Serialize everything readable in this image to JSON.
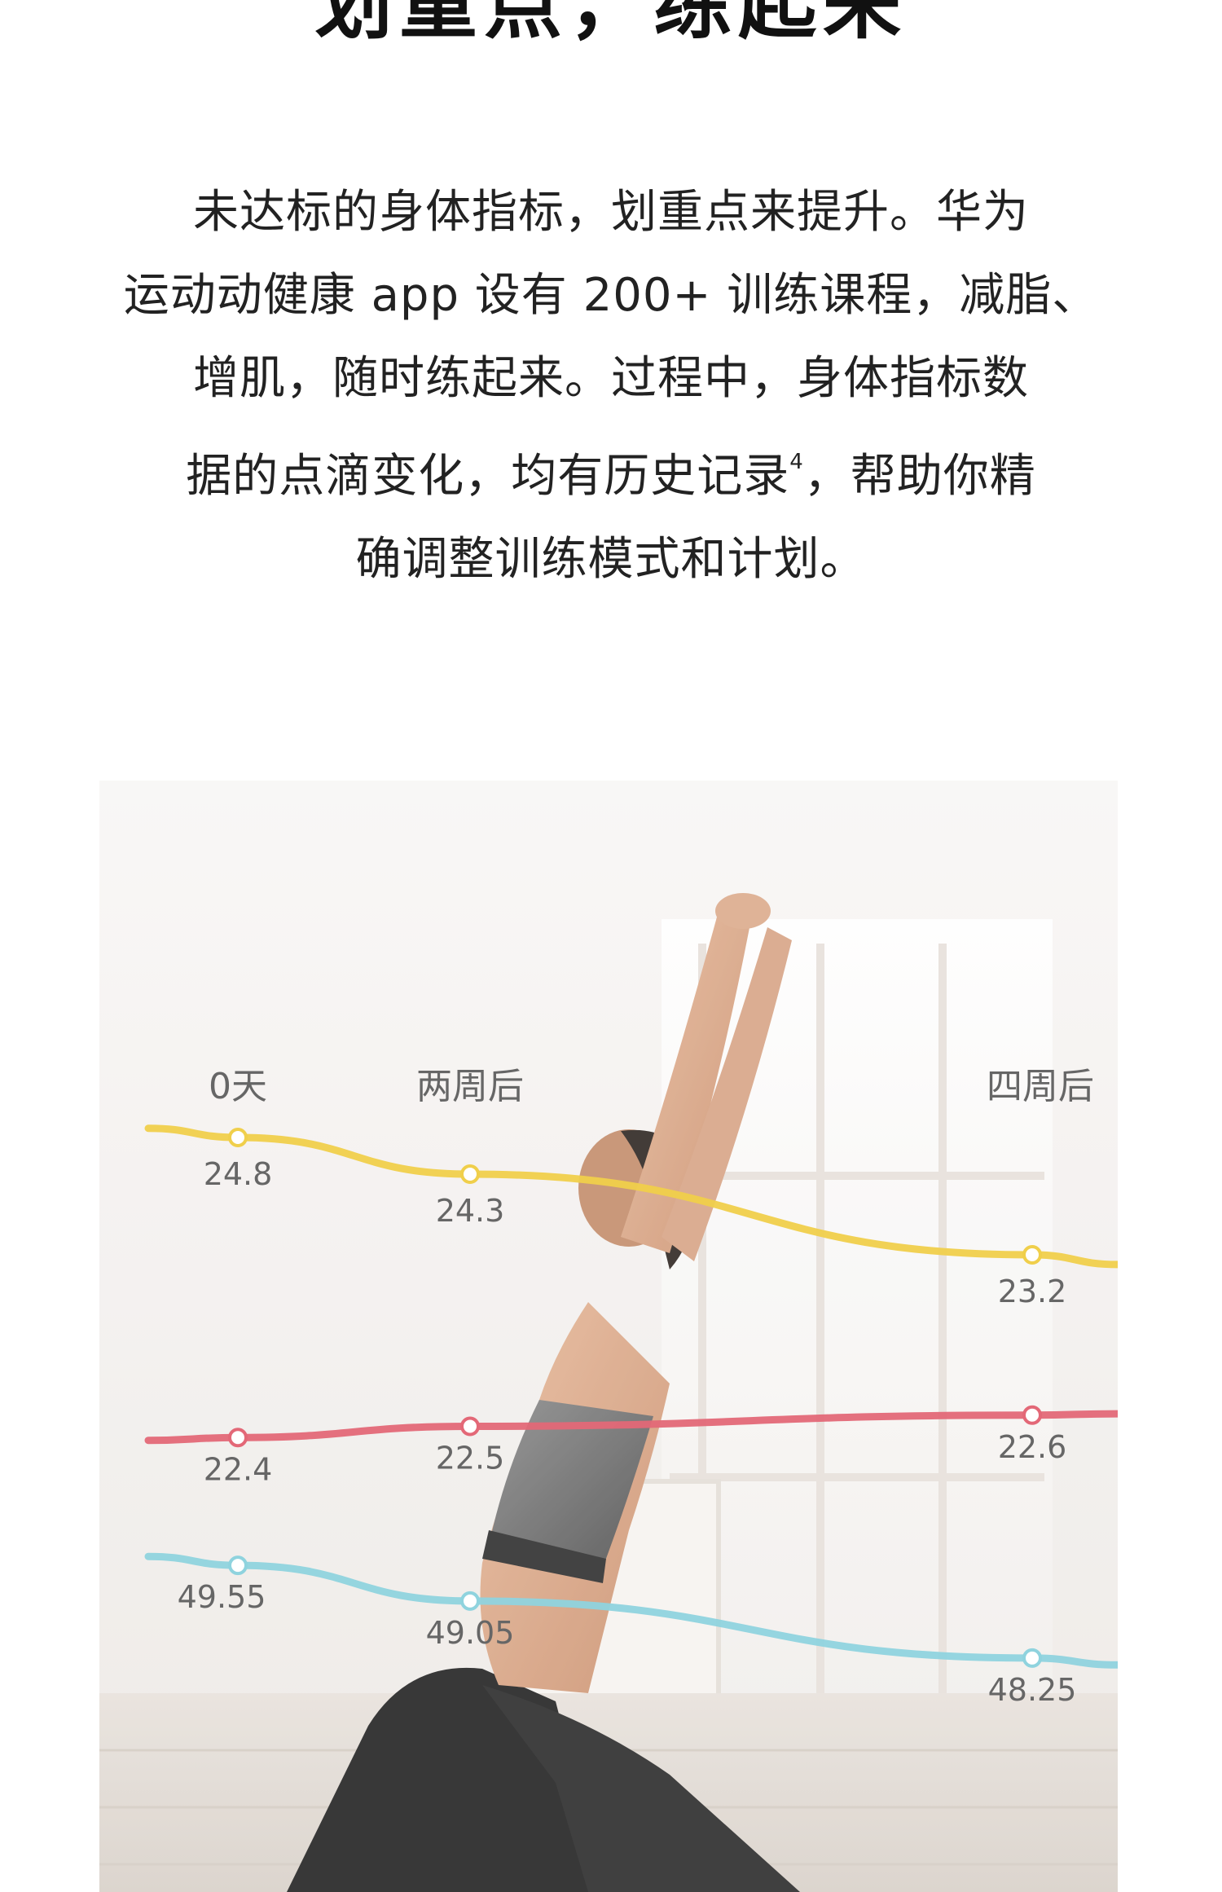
{
  "header": {
    "headline": "划重点，练起来"
  },
  "intro": {
    "line1": "未达标的身体指标，划重点来提升。华为",
    "line2": "运动动健康 app 设有 200+ 训练课程，减脂、",
    "line3": "增肌，随时练起来。过程中，身体指标数",
    "line4_a": "据的点滴变化，均有历史记录",
    "line4_sup": "4",
    "line4_b": "，帮助你精",
    "line5": "确调整训练模式和计划。"
  },
  "chart_data": {
    "type": "line",
    "categories": [
      "0天",
      "两周后",
      "四周后"
    ],
    "series": [
      {
        "values": [
          24.8,
          24.3,
          23.2
        ],
        "labels": [
          "24.8",
          "24.3",
          "23.2"
        ],
        "color": "#f0cf4b"
      },
      {
        "values": [
          22.4,
          22.5,
          22.6
        ],
        "labels": [
          "22.4",
          "22.5",
          "22.6"
        ],
        "color": "#e36877"
      },
      {
        "values": [
          49.55,
          49.05,
          48.25
        ],
        "labels": [
          "49.55",
          "49.05",
          "48.25"
        ],
        "color": "#8fd3de"
      }
    ],
    "title": "",
    "xlabel": "",
    "ylabel": "",
    "grid": false,
    "legend": "none"
  },
  "photo": {
    "icon": "yoga-woman-illustration"
  }
}
